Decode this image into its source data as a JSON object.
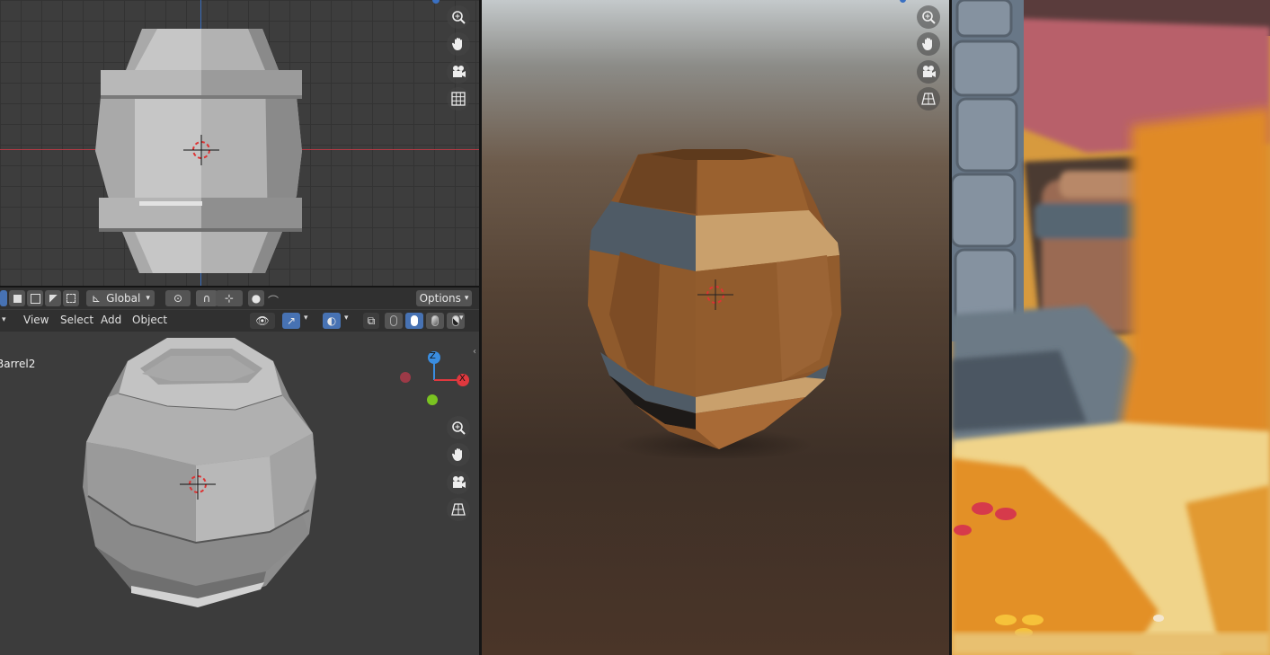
{
  "header": {
    "orientation_value": "Global",
    "options_label": "Options",
    "menus": [
      "View",
      "Select",
      "Add",
      "Object"
    ]
  },
  "viewport_persp": {
    "object_name": "Barrel2",
    "gizmo": {
      "z": "Z",
      "x": "X"
    }
  },
  "colors": {
    "x_axis": "#e0383e",
    "y_axis": "#7ac321",
    "z_axis": "#3a8de0",
    "active_toggle": "#4772b3",
    "barrel_wood": "#8e5a2c",
    "barrel_band": "#4f5b66"
  },
  "icons": [
    "zoom-icon",
    "hand-icon",
    "camera-icon",
    "grid-icon",
    "ortho-icon",
    "cursor-icon"
  ]
}
